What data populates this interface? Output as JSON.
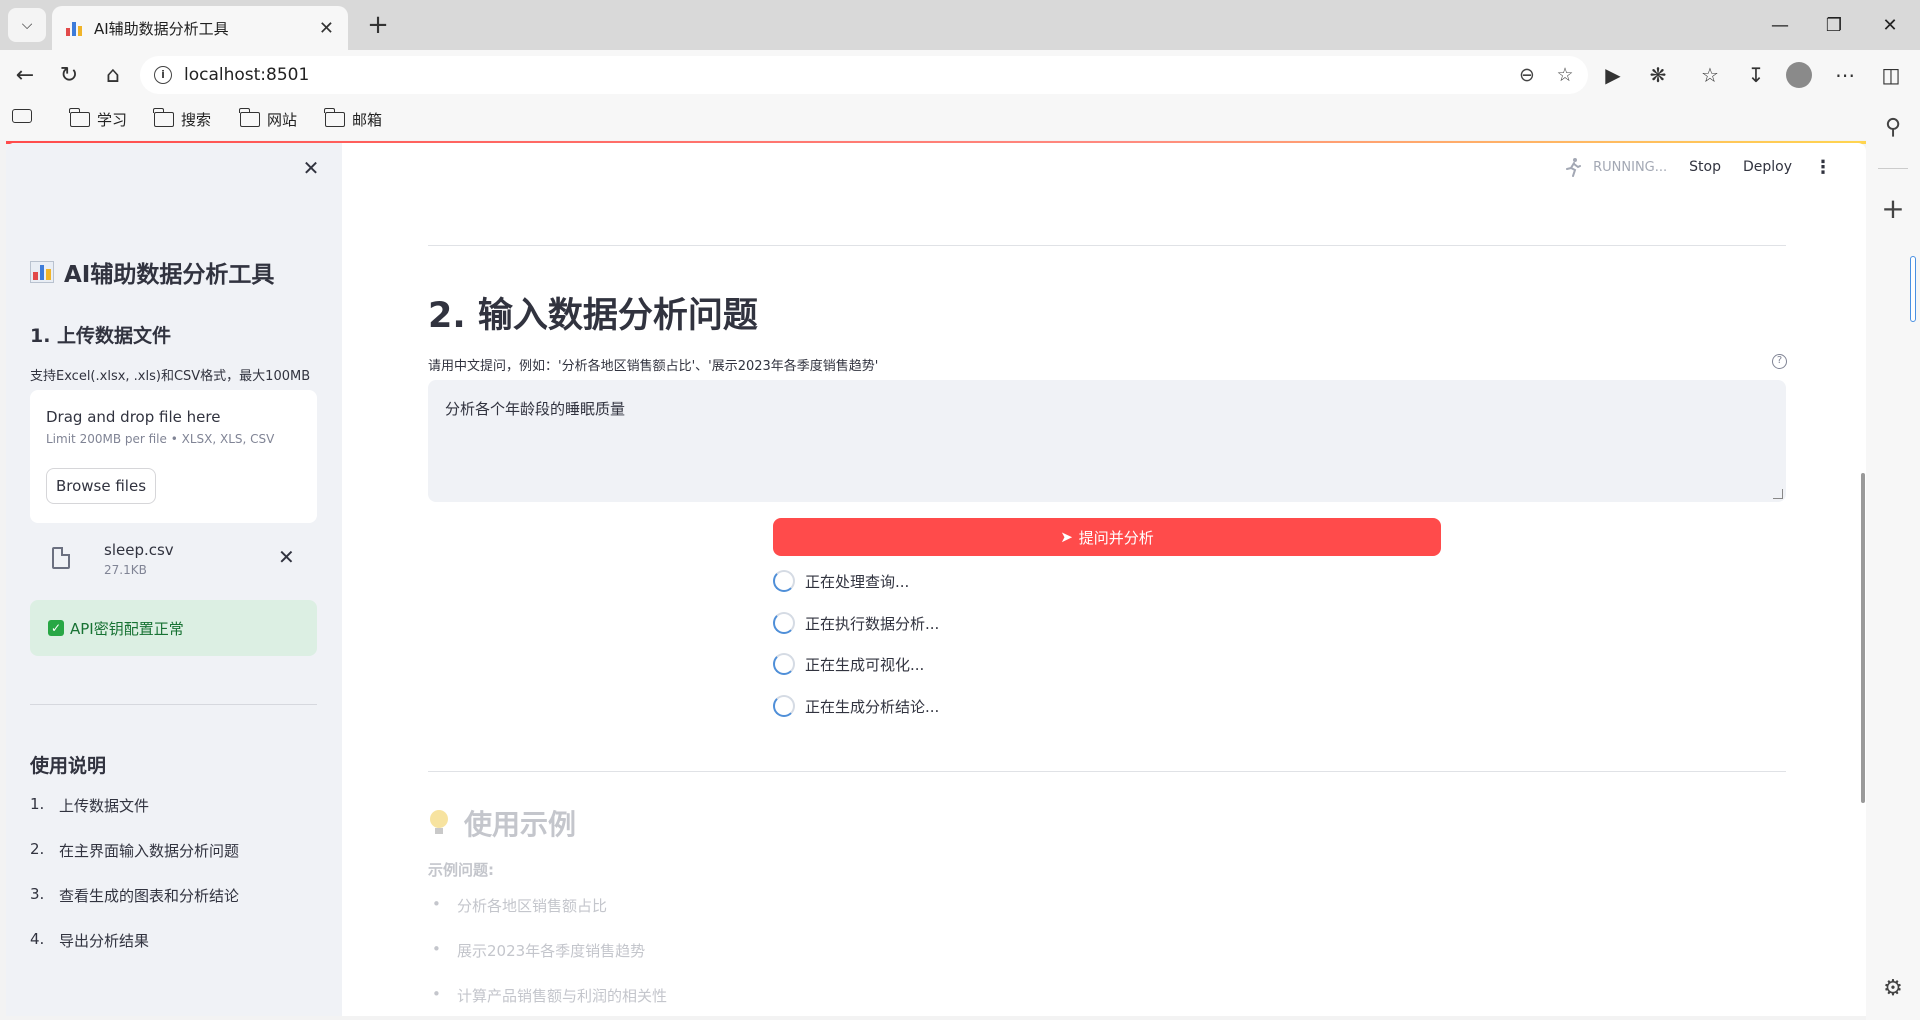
{
  "browser": {
    "tab_title": "AI辅助数据分析工具",
    "url": "localhost:8501",
    "bookmarks": [
      "学习",
      "搜索",
      "网站",
      "邮箱"
    ]
  },
  "header": {
    "running_text": "RUNNING...",
    "stop_label": "Stop",
    "deploy_label": "Deploy"
  },
  "sidebar": {
    "title": "AI辅助数据分析工具",
    "upload_heading": "1. 上传数据文件",
    "upload_help": "支持Excel(.xlsx, .xls)和CSV格式，最大100MB",
    "dropzone_title": "Drag and drop file here",
    "dropzone_limit": "Limit 200MB per file • XLSX, XLS, CSV",
    "browse_label": "Browse files",
    "file_name": "sleep.csv",
    "file_size": "27.1KB",
    "api_status": "API密钥配置正常",
    "instructions_heading": "使用说明",
    "steps": [
      {
        "num": "1.",
        "text": "上传数据文件"
      },
      {
        "num": "2.",
        "text": "在主界面输入数据分析问题"
      },
      {
        "num": "3.",
        "text": "查看生成的图表和分析结论"
      },
      {
        "num": "4.",
        "text": "导出分析结果"
      }
    ]
  },
  "main": {
    "section_title": "2. 输入数据分析问题",
    "question_label": "请用中文提问，例如：'分析各地区销售额占比'、'展示2023年各季度销售趋势'",
    "question_value": "分析各个年龄段的睡眠质量",
    "submit_label": "提问并分析",
    "spinners": [
      "正在处理查询...",
      "正在执行数据分析...",
      "正在生成可视化...",
      "正在生成分析结论..."
    ],
    "examples_title": "使用示例",
    "examples_label": "示例问题:",
    "examples": [
      "分析各地区销售额占比",
      "展示2023年各季度销售趋势",
      "计算产品销售额与利润的相关性"
    ]
  },
  "colors": {
    "primary": "#ff4b4b",
    "success_bg": "#dcefe3",
    "success_text": "#177233",
    "sidebar_bg": "#f0f2f6"
  }
}
